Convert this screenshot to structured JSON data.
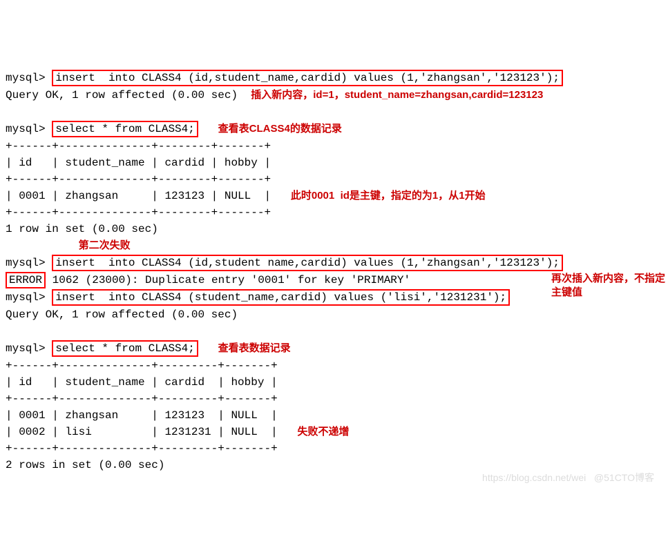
{
  "prompt": "mysql>",
  "cmd1": "insert  into CLASS4 (id,student_name,cardid) values (1,'zhangsan','123123');",
  "ok1": "Query OK, 1 row affected (0.00 sec)",
  "anno1": "插入新内容，id=1，student_name=zhangsan,cardid=123123",
  "cmd2": "select * from CLASS4;",
  "anno2": "查看表CLASS4的数据记录",
  "tbl1_headers": "| id   | student_name | cardid | hobby |",
  "tbl1_row1": "| 0001 | zhangsan     | 123123 | NULL  |",
  "tbl1_border": "+------+--------------+--------+-------+",
  "anno3": "此时0001  id是主键，指定的为1，从1开始",
  "rows1": "1 row in set (0.00 sec)",
  "anno_fail": "第二次失败",
  "cmd3": "insert  into CLASS4 (id,student name,cardid) values (1,'zhangsan','123123');",
  "error_word": "ERROR",
  "error_rest": " 1062 (23000): Duplicate entry '0001' for key 'PRIMARY'",
  "cmd4": "insert  into CLASS4 (student_name,cardid) values ('lisi','1231231');",
  "anno4": "再次插入新内容，不指定主键值",
  "ok2": "Query OK, 1 row affected (0.00 sec)",
  "cmd5": "select * from CLASS4;",
  "anno5": "查看表数据记录",
  "tbl2_border": "+------+--------------+---------+-------+",
  "tbl2_headers": "| id   | student_name | cardid  | hobby |",
  "tbl2_row1": "| 0001 | zhangsan     | 123123  | NULL  |",
  "tbl2_row2": "| 0002 | lisi         | 1231231 | NULL  |",
  "anno6": "失败不递增",
  "rows2": "2 rows in set (0.00 sec)",
  "watermark": "https://blog.csdn.net/wei   @51CTO博客"
}
